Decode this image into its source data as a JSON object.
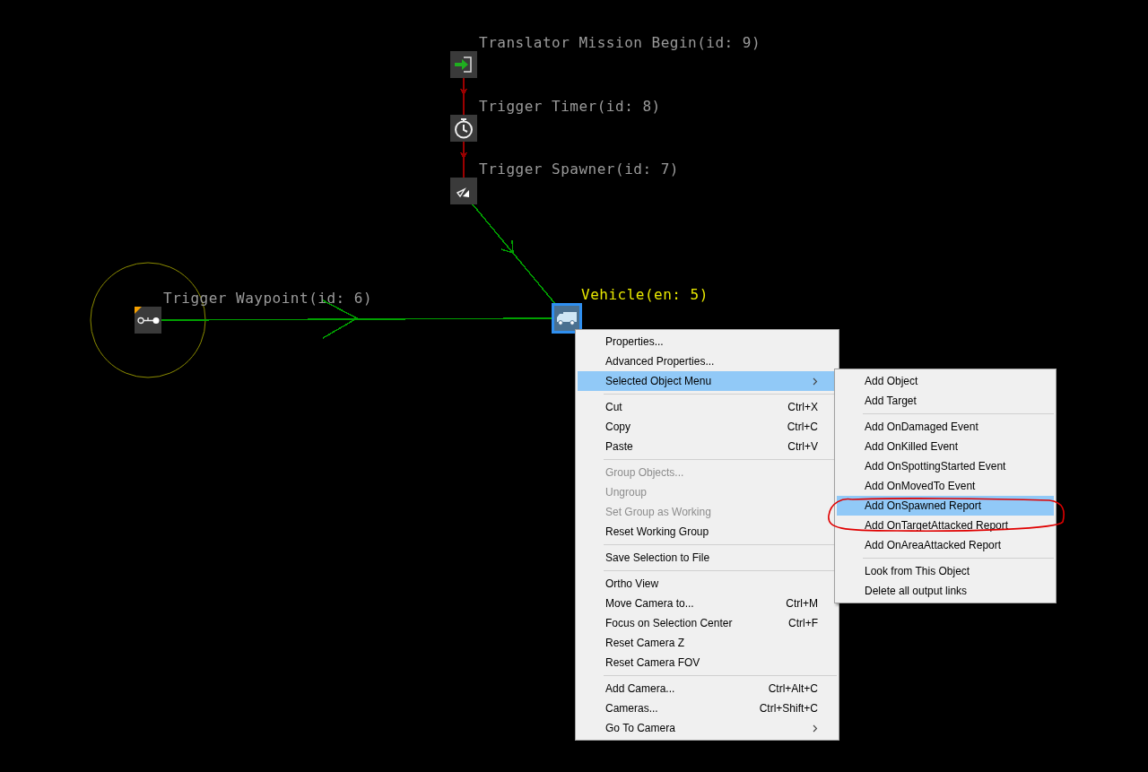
{
  "canvas": {
    "nodes": [
      {
        "kind": "mission-begin",
        "label": "Translator Mission Begin(id: 9)",
        "selected": false
      },
      {
        "kind": "timer",
        "label": "Trigger Timer(id: 8)",
        "selected": false
      },
      {
        "kind": "spawner",
        "label": "Trigger Spawner(id: 7)",
        "selected": false
      },
      {
        "kind": "waypoint",
        "label": "Trigger Waypoint(id: 6)",
        "selected": false
      },
      {
        "kind": "vehicle",
        "label": "Vehicle(en: 5)",
        "selected": true
      }
    ],
    "links": [
      {
        "color": "#9b0000"
      },
      {
        "color": "#9b0000"
      },
      {
        "color": "#00a000"
      },
      {
        "color": "#00a000"
      }
    ]
  },
  "context_menu": {
    "items": [
      {
        "kind": "item",
        "label": "Properties...",
        "disabled": false,
        "selected": false
      },
      {
        "kind": "item",
        "label": "Advanced Properties...",
        "disabled": false,
        "selected": false
      },
      {
        "kind": "submenu",
        "label": "Selected Object Menu",
        "disabled": false,
        "selected": true
      },
      {
        "kind": "separator"
      },
      {
        "kind": "item",
        "label": "Cut",
        "shortcut": "Ctrl+X",
        "disabled": false,
        "selected": false
      },
      {
        "kind": "item",
        "label": "Copy",
        "shortcut": "Ctrl+C",
        "disabled": false,
        "selected": false
      },
      {
        "kind": "item",
        "label": "Paste",
        "shortcut": "Ctrl+V",
        "disabled": false,
        "selected": false
      },
      {
        "kind": "separator"
      },
      {
        "kind": "item",
        "label": "Group Objects...",
        "disabled": true,
        "selected": false
      },
      {
        "kind": "item",
        "label": "Ungroup",
        "disabled": true,
        "selected": false
      },
      {
        "kind": "item",
        "label": "Set Group as Working",
        "disabled": true,
        "selected": false
      },
      {
        "kind": "item",
        "label": "Reset Working Group",
        "disabled": false,
        "selected": false
      },
      {
        "kind": "separator"
      },
      {
        "kind": "item",
        "label": "Save Selection to File",
        "disabled": false,
        "selected": false
      },
      {
        "kind": "separator"
      },
      {
        "kind": "item",
        "label": "Ortho View",
        "disabled": false,
        "selected": false
      },
      {
        "kind": "item",
        "label": "Move Camera to...",
        "shortcut": "Ctrl+M",
        "disabled": false,
        "selected": false
      },
      {
        "kind": "item",
        "label": "Focus on Selection Center",
        "shortcut": "Ctrl+F",
        "disabled": false,
        "selected": false
      },
      {
        "kind": "item",
        "label": "Reset Camera Z",
        "disabled": false,
        "selected": false
      },
      {
        "kind": "item",
        "label": "Reset Camera FOV",
        "disabled": false,
        "selected": false
      },
      {
        "kind": "separator"
      },
      {
        "kind": "item",
        "label": "Add Camera...",
        "shortcut": "Ctrl+Alt+C",
        "disabled": false,
        "selected": false
      },
      {
        "kind": "item",
        "label": "Cameras...",
        "shortcut": "Ctrl+Shift+C",
        "disabled": false,
        "selected": false
      },
      {
        "kind": "submenu",
        "label": "Go To Camera",
        "disabled": false,
        "selected": false
      }
    ]
  },
  "submenu": {
    "items": [
      {
        "kind": "item",
        "label": "Add Object",
        "selected": false
      },
      {
        "kind": "item",
        "label": "Add Target",
        "selected": false
      },
      {
        "kind": "separator"
      },
      {
        "kind": "item",
        "label": "Add OnDamaged Event",
        "selected": false
      },
      {
        "kind": "item",
        "label": "Add OnKilled Event",
        "selected": false
      },
      {
        "kind": "item",
        "label": "Add OnSpottingStarted Event",
        "selected": false
      },
      {
        "kind": "item",
        "label": "Add OnMovedTo Event",
        "selected": false
      },
      {
        "kind": "item",
        "label": "Add OnSpawned Report",
        "selected": true
      },
      {
        "kind": "item",
        "label": "Add OnTargetAttacked Report",
        "selected": false
      },
      {
        "kind": "item",
        "label": "Add OnAreaAttacked Report",
        "selected": false
      },
      {
        "kind": "separator"
      },
      {
        "kind": "item",
        "label": "Look from This Object",
        "selected": false
      },
      {
        "kind": "item",
        "label": "Delete all output links",
        "selected": false
      }
    ]
  }
}
